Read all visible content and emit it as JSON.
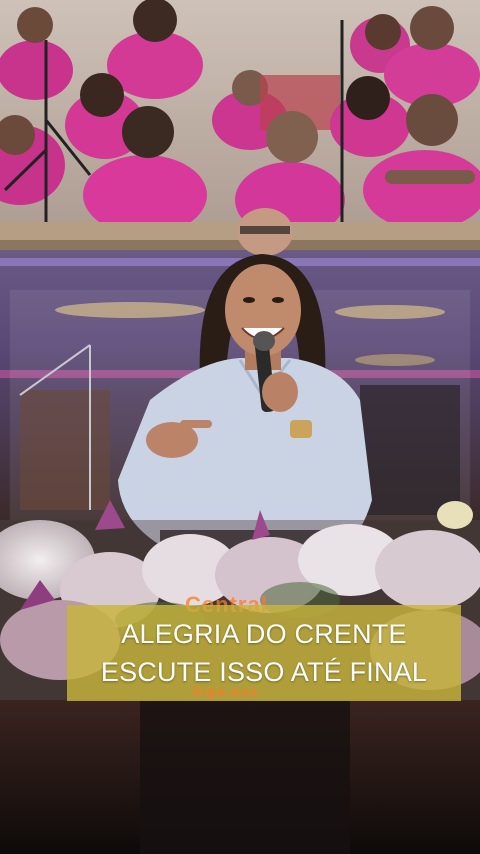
{
  "caption": {
    "line1": "ALEGRIA DO CRENTE",
    "line2": "ESCUTE ISSO ATÉ FINAL"
  },
  "watermark": {
    "top": "Central",
    "bottom": "Siga-nos"
  },
  "colors": {
    "choir_robe": "#d0338f",
    "caption_bg": "#c8b43c",
    "shirt": "#c9d3e4",
    "backdrop": "#c9beb5"
  }
}
